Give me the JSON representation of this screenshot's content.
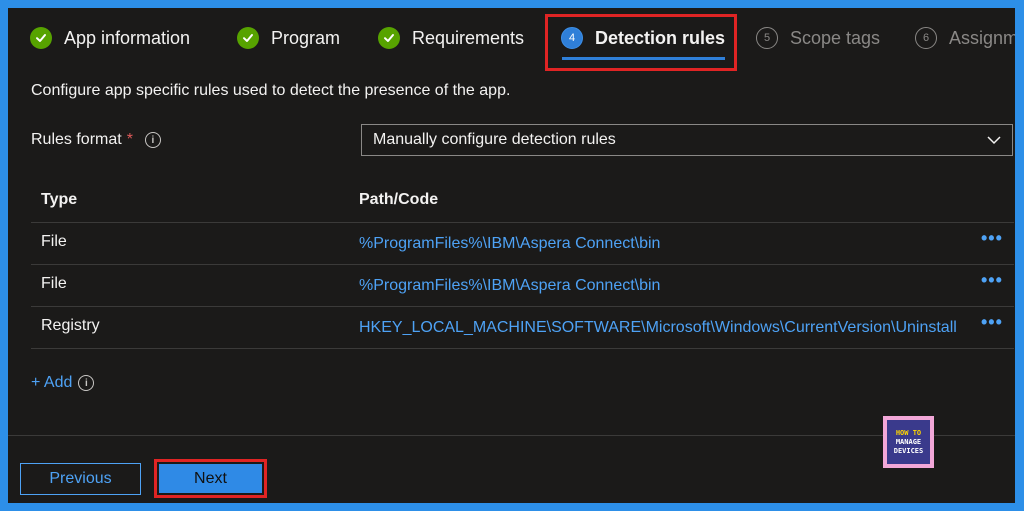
{
  "steps": [
    {
      "label": "App information",
      "state": "done"
    },
    {
      "label": "Program",
      "state": "done"
    },
    {
      "label": "Requirements",
      "state": "done"
    },
    {
      "number": "4",
      "label": "Detection rules",
      "state": "current"
    },
    {
      "number": "5",
      "label": "Scope tags",
      "state": "todo"
    },
    {
      "number": "6",
      "label": "Assignm",
      "state": "todo"
    }
  ],
  "description": "Configure app specific rules used to detect the presence of the app.",
  "rules_format": {
    "label": "Rules format",
    "required_mark": "*",
    "info_glyph": "i",
    "selected": "Manually configure detection rules"
  },
  "table": {
    "headers": {
      "type": "Type",
      "path": "Path/Code"
    },
    "rows": [
      {
        "type": "File",
        "path": "%ProgramFiles%\\IBM\\Aspera Connect\\bin",
        "more": "•••"
      },
      {
        "type": "File",
        "path": "%ProgramFiles%\\IBM\\Aspera Connect\\bin",
        "more": "•••"
      },
      {
        "type": "Registry",
        "path": "HKEY_LOCAL_MACHINE\\SOFTWARE\\Microsoft\\Windows\\CurrentVersion\\Uninstall",
        "more": "•••"
      }
    ]
  },
  "add_label": "+ Add",
  "add_info_glyph": "i",
  "buttons": {
    "previous": "Previous",
    "next": "Next"
  },
  "logo": {
    "line1": "HOW TO",
    "line2": "MANAGE",
    "line3": "DEVICES"
  },
  "colors": {
    "accent": "#2f8ae6",
    "link": "#4ea2f5",
    "success": "#57a300",
    "highlight": "#e02424"
  }
}
